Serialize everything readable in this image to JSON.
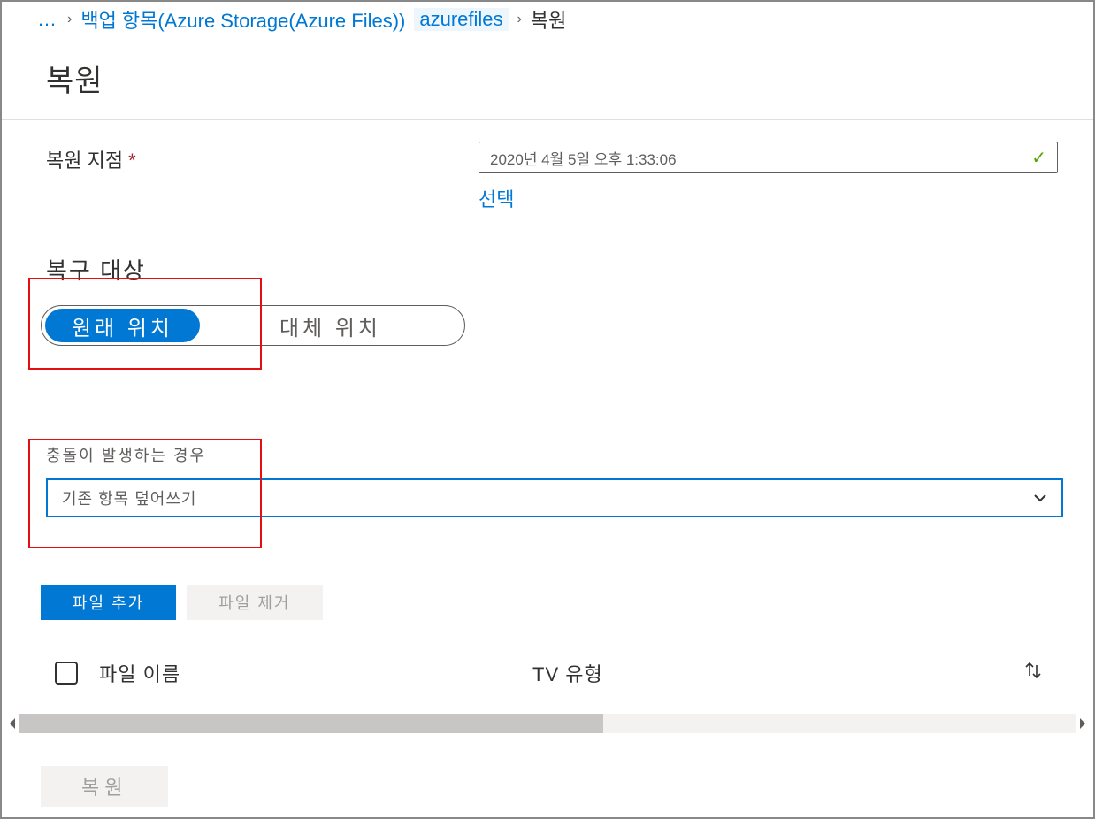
{
  "breadcrumb": {
    "dots": "…",
    "item1": "백업 항목(Azure Storage(Azure Files))",
    "item2": "azurefiles",
    "current": "복원"
  },
  "page_title": "복원",
  "restore_point": {
    "label": "복원 지점",
    "value": "2020년 4월 5일 오후 1:33:06",
    "select_link": "선택"
  },
  "recovery_target": {
    "title": "복구 대상",
    "opt_original": "원래 위치",
    "opt_alternate": "대체 위치"
  },
  "conflict": {
    "label": "충돌이 발생하는 경우",
    "value": "기존 항목 덮어쓰기"
  },
  "buttons": {
    "add_file": "파일 추가",
    "remove_file": "파일 제거"
  },
  "table": {
    "col_name": "파일 이름",
    "col_type": "TV 유형"
  },
  "footer": {
    "restore": "복원"
  }
}
